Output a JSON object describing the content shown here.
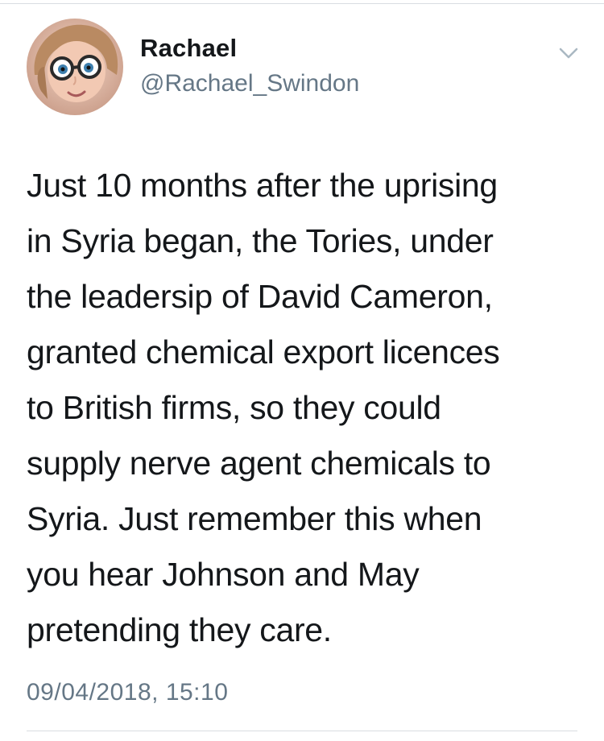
{
  "tweet": {
    "display_name": "Rachael",
    "handle": "@Rachael_Swindon",
    "body_lines": [
      "Just 10 months after the uprising",
      "in Syria began, the Tories, under",
      "the leadersip of David Cameron,",
      "granted chemical export licences",
      "to British firms, so they could",
      "supply nerve agent chemicals to",
      "Syria. Just remember this when",
      "you hear Johnson and May",
      "pretending they care."
    ],
    "timestamp": "09/04/2018, 15:10",
    "menu_icon": "chevron-down-icon",
    "avatar_icon": "avatar-cartoon-glasses"
  },
  "colors": {
    "text_primary": "#14171a",
    "text_secondary": "#657786",
    "divider": "#d9dde1"
  }
}
